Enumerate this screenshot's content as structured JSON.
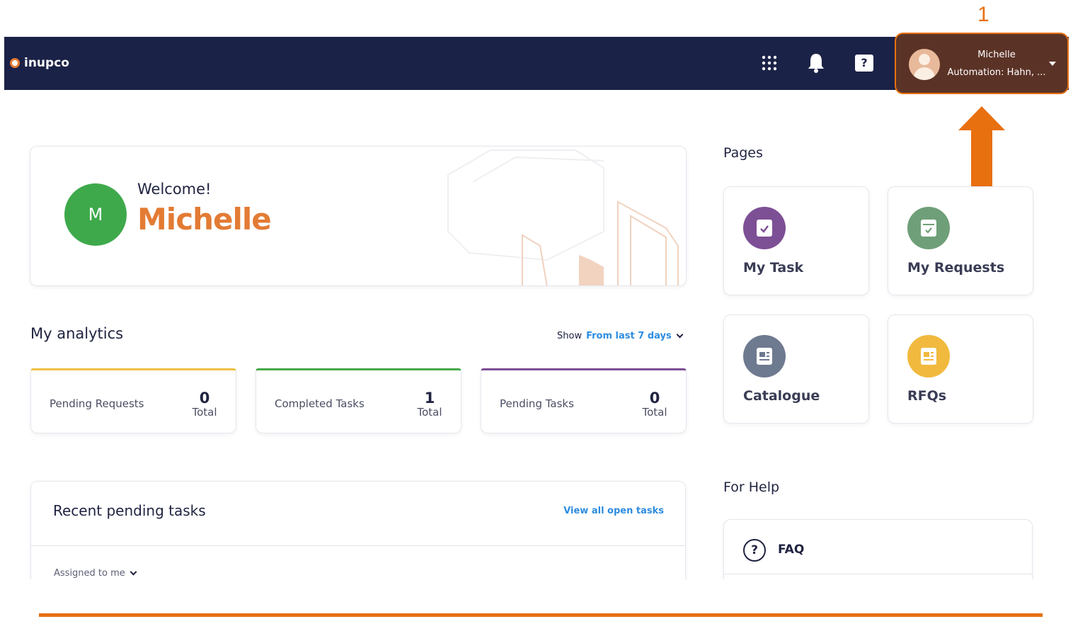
{
  "annotation": {
    "step_number": "1",
    "accent_color": "#e8700f"
  },
  "topbar": {
    "logo_text": "inupco",
    "icons": [
      "apps-grid-icon",
      "bell-icon",
      "help-icon"
    ],
    "help_glyph": "?",
    "user": {
      "name": "Michelle",
      "role": "Automation: Hahn, ..."
    }
  },
  "welcome": {
    "greeting": "Welcome!",
    "name": "Michelle",
    "avatar_initial": "M",
    "avatar_color": "#3ea94b"
  },
  "pages": {
    "title": "Pages",
    "items": [
      {
        "label": "My Task",
        "icon": "task-icon",
        "color": "#7d4f95"
      },
      {
        "label": "My Requests",
        "icon": "requests-icon",
        "color": "#6f9f78"
      },
      {
        "label": "Catalogue",
        "icon": "catalogue-icon",
        "color": "#6e7a90"
      },
      {
        "label": "RFQs",
        "icon": "rfq-icon",
        "color": "#f1b93e"
      }
    ]
  },
  "analytics": {
    "title": "My analytics",
    "show_label": "Show",
    "range_label": "From last 7 days",
    "stats": [
      {
        "label": "Pending Requests",
        "value": "0",
        "total_label": "Total",
        "accent": "#efc145"
      },
      {
        "label": "Completed Tasks",
        "value": "1",
        "total_label": "Total",
        "accent": "#47a84a"
      },
      {
        "label": "Pending Tasks",
        "value": "0",
        "total_label": "Total",
        "accent": "#7d4f95"
      }
    ]
  },
  "recent": {
    "title": "Recent pending tasks",
    "view_all": "View all open tasks",
    "filter_label": "Assigned to me"
  },
  "help": {
    "title": "For Help",
    "faq_label": "FAQ",
    "faq_glyph": "?"
  }
}
